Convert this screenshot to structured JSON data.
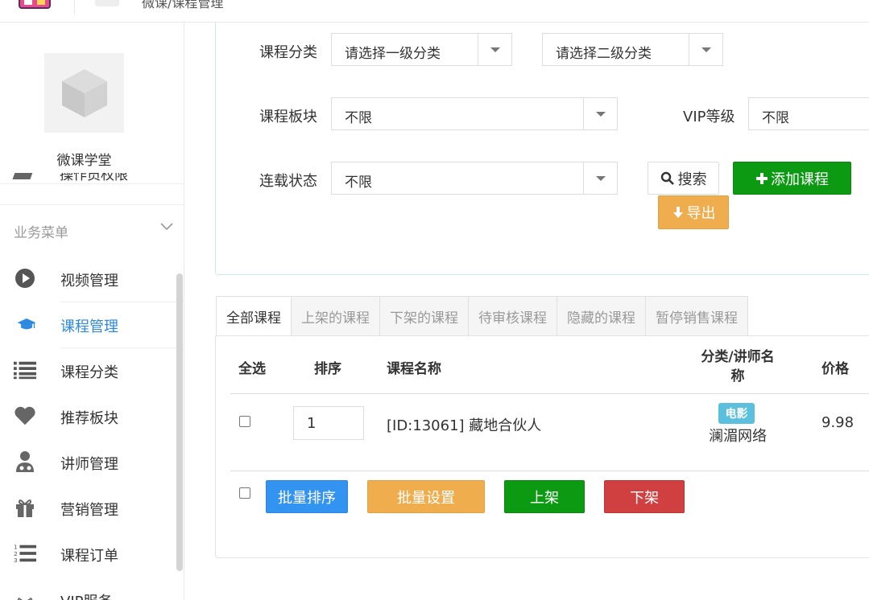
{
  "topbar": {
    "breadcrumb": "微课/课程管理"
  },
  "sidebar": {
    "brand_name": "微课学堂",
    "cut_item": "操作员权限",
    "group_title": "业务菜单",
    "items": [
      {
        "label": "视频管理",
        "icon": "play-circle-icon"
      },
      {
        "label": "课程管理",
        "icon": "graduation-cap-icon",
        "active": true
      },
      {
        "label": "课程分类",
        "icon": "list-icon"
      },
      {
        "label": "推荐板块",
        "icon": "heart-icon"
      },
      {
        "label": "讲师管理",
        "icon": "user-doctor-icon"
      },
      {
        "label": "营销管理",
        "icon": "gift-icon"
      },
      {
        "label": "课程订单",
        "icon": "ordered-list-icon"
      },
      {
        "label": "VIP服务",
        "icon": "crown-icon"
      }
    ]
  },
  "filters": {
    "category_label": "课程分类",
    "category_level1": "请选择一级分类",
    "category_level2": "请选择二级分类",
    "block_label": "课程板块",
    "block_value": "不限",
    "vip_label": "VIP等级",
    "vip_value": "不限",
    "status_label": "连载状态",
    "status_value": "不限"
  },
  "actions": {
    "search": "搜索",
    "add": "添加课程",
    "export": "导出"
  },
  "tabs": [
    "全部课程",
    "上架的课程",
    "下架的课程",
    "待审核课程",
    "隐藏的课程",
    "暂停销售课程"
  ],
  "table": {
    "headers": {
      "select_all": "全选",
      "sort": "排序",
      "name": "课程名称",
      "category_teacher": "分类/讲师名称",
      "price": "价格"
    },
    "rows": [
      {
        "sort": "1",
        "name": "[ID:13061] 藏地合伙人",
        "category": "电影",
        "teacher": "澜湄网络",
        "price": "9.98"
      }
    ]
  },
  "batch": {
    "sort": "批量排序",
    "settings": "批量设置",
    "on_shelf": "上架",
    "off_shelf": "下架"
  },
  "colors": {
    "accent": "#2b8ae0",
    "green": "#0d9a13",
    "orange": "#f0ad4e",
    "red": "#d04040",
    "blue": "#3393f0",
    "tag": "#5bc0de"
  }
}
